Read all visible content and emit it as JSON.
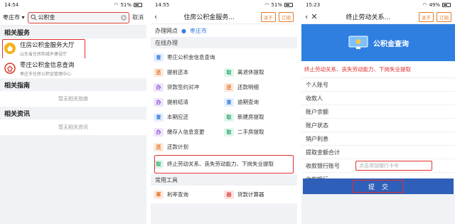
{
  "screen1": {
    "time": "14:54",
    "battery": "51%",
    "city": "枣庄市",
    "search_value": "公积金",
    "cancel": "取消",
    "section_services": "相关服务",
    "services": [
      {
        "title": "住房公积金服务大厅",
        "subtitle": "山东省住房和城乡建设厅"
      },
      {
        "title": "枣庄公积金信息查询",
        "subtitle": "枣庄市住房公积金管理中心"
      }
    ],
    "section_guides": "相关指南",
    "guides_empty": "暂无相关指南",
    "section_news": "相关资讯",
    "news_empty": "暂无相关资讯"
  },
  "screen2": {
    "time": "14:55",
    "battery": "51%",
    "title": "住房公积金服务...",
    "follow": "关于",
    "subscribe": "订阅",
    "branch_label": "办理网点",
    "branch_city": "枣庄市",
    "group_online": "在线办理",
    "tags": {
      "query": "查",
      "repay": "还",
      "handle": "办",
      "extract": "取",
      "rate": "率",
      "tool": "器"
    },
    "items": {
      "info_query": "枣庄公积金信息查询",
      "early_repay": "提前还本",
      "offline_extract": "离退休提取",
      "loan_check": "贷款签约对冲",
      "repay_detail": "还款明细",
      "early_settle": "提前结清",
      "overdue_query": "逾期查询",
      "period_repay": "本期应还",
      "new_house": "新建房提取",
      "deposit_change": "缴存人信息变更",
      "second_house": "二手房提取",
      "repay_plan": "还款计划",
      "unemployed": "终止劳动关系、丧失劳动能力、下岗失业提取"
    },
    "group_tools": "常用工具",
    "tools": {
      "rate_query": "利率查询",
      "loan_calc": "贷款计算器"
    }
  },
  "screen3": {
    "time": "15:23",
    "battery": "49%",
    "title": "终止劳动关系...",
    "follow": "关于",
    "subscribe": "订阅",
    "banner_text": "公积金查询",
    "form_title": "终止劳动关系、丧失劳动能力、下岗失业提取",
    "fields": [
      "个人账号",
      "收款人",
      "账户余额",
      "账户状态",
      "销户利息",
      "提取金额合计",
      "收款银行账号",
      "收款银行"
    ],
    "bank_account_placeholder": "点击添加银行卡号",
    "submit": "提交"
  },
  "colors": {
    "accent": "#2f7fe0",
    "highlight": "#e03030",
    "orange": "#e67a24"
  }
}
